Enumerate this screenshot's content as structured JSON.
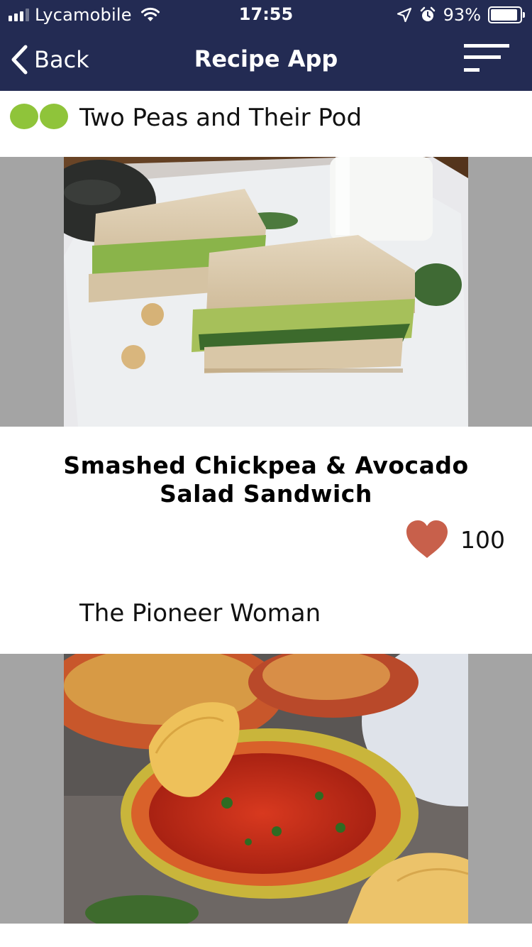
{
  "status_bar": {
    "carrier": "Lycamobile",
    "time": "17:55",
    "battery_percent": "93%",
    "battery_level": 0.93
  },
  "nav": {
    "back_label": "Back",
    "title": "Recipe App",
    "menu_icon": "sort-menu-icon"
  },
  "colors": {
    "nav_background": "#232b53",
    "heart": "#c8604b",
    "pea_green": "#8fc43a",
    "photo_band": "#a4a4a4"
  },
  "feed": [
    {
      "source": "Two Peas and Their Pod",
      "source_logo": "two-peas-logo",
      "image": "chickpea-avocado-sandwich-photo",
      "title_line1": "Smashed Chickpea & Avocado",
      "title_line2": "Salad Sandwich",
      "likes": "100"
    },
    {
      "source": "The Pioneer Woman",
      "image": "salsa-and-chips-photo"
    }
  ]
}
